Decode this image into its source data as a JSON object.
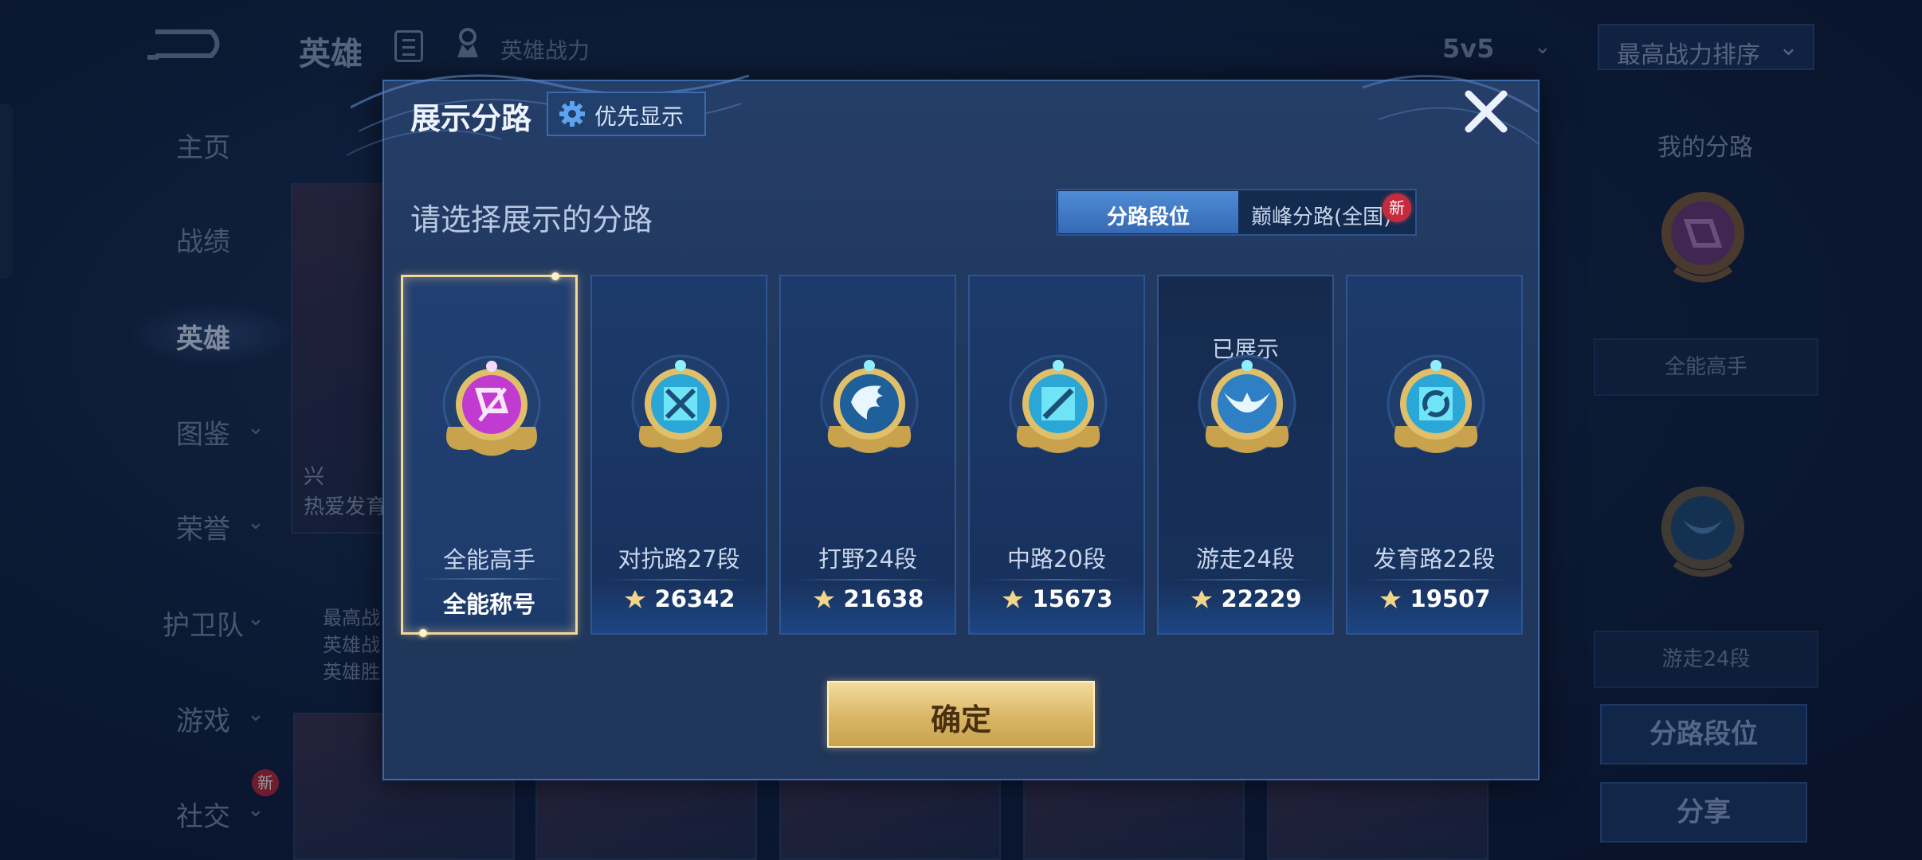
{
  "background": {
    "page_title": "英雄",
    "power_label": "英雄战力",
    "mode_select": "5v5",
    "sort_select": "最高战力排序",
    "nav_items": [
      {
        "label": "主页"
      },
      {
        "label": "战绩"
      },
      {
        "label": "英雄"
      },
      {
        "label": "图鉴"
      },
      {
        "label": "荣誉"
      },
      {
        "label": "护卫队"
      },
      {
        "label": "游戏"
      },
      {
        "label": "社交"
      }
    ],
    "nav_new_badge": "新",
    "hero_card_text_1": "热爱发育",
    "hero_card_text_2": "兴",
    "hero_stats": [
      "最高战",
      "英雄战",
      "英雄胜"
    ],
    "right_panel": {
      "title": "我的分路",
      "plate_1": "全能高手",
      "plate_2": "游走24段",
      "btn_rank": "分路段位",
      "btn_share": "分享"
    }
  },
  "modal": {
    "title": "展示分路",
    "priority_button": "优先显示",
    "prompt": "请选择展示的分路",
    "tabs": [
      {
        "label": "分路段位"
      },
      {
        "label": "巅峰分路(全国)"
      }
    ],
    "tab_new_badge": "新",
    "cards": [
      {
        "rank": "全能高手",
        "score": "全能称号",
        "emblem": "allround-emblem",
        "shown": ""
      },
      {
        "rank": "对抗路27段",
        "score": "26342",
        "emblem": "clash-lane-emblem",
        "shown": ""
      },
      {
        "rank": "打野24段",
        "score": "21638",
        "emblem": "jungle-emblem",
        "shown": ""
      },
      {
        "rank": "中路20段",
        "score": "15673",
        "emblem": "mid-lane-emblem",
        "shown": ""
      },
      {
        "rank": "游走24段",
        "score": "22229",
        "emblem": "roam-emblem",
        "shown": "已展示"
      },
      {
        "rank": "发育路22段",
        "score": "19507",
        "emblem": "farm-lane-emblem",
        "shown": ""
      }
    ],
    "confirm": "确定"
  },
  "colors": {
    "accent_gold": "#d9b665",
    "tab_active": "#3669b4",
    "allround_purple": "#c23bd0",
    "lane_cyan": "#3fd2f0"
  }
}
